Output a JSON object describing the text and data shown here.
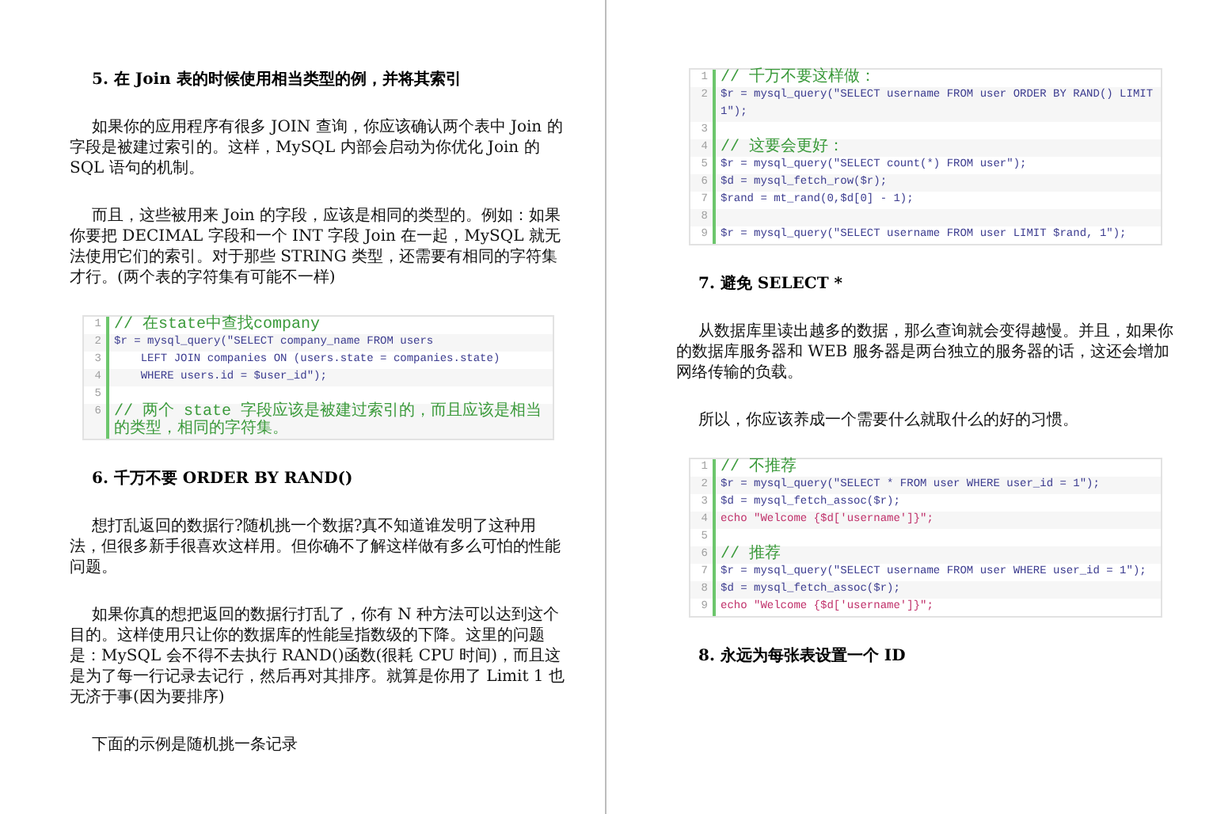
{
  "pages": [
    {
      "blocks": [
        {
          "kind": "heading",
          "text": "5. 在 Join 表的时候使用相当类型的例，并将其索引"
        },
        {
          "kind": "paragraph",
          "text": "如果你的应用程序有很多 JOIN 查询，你应该确认两个表中 Join 的字段是被建过索引的。这样，MySQL 内部会启动为你优化 Join 的 SQL 语句的机制。"
        },
        {
          "kind": "paragraph",
          "text": "而且，这些被用来 Join 的字段，应该是相同的类型的。例如：如果你要把 DECIMAL 字段和一个 INT 字段 Join 在一起，MySQL 就无法使用它们的索引。对于那些 STRING 类型，还需要有相同的字符集才行。(两个表的字符集有可能不一样)"
        },
        {
          "kind": "code",
          "lines": [
            {
              "num": "1",
              "kind": "comment",
              "text": "// 在state中查找company"
            },
            {
              "num": "2",
              "kind": "code",
              "text": "$r = mysql_query(\"SELECT company_name FROM users"
            },
            {
              "num": "3",
              "kind": "code",
              "text": "    LEFT JOIN companies ON (users.state = companies.state)"
            },
            {
              "num": "4",
              "kind": "code",
              "text": "    WHERE users.id = $user_id\");"
            },
            {
              "num": "5",
              "kind": "blank"
            },
            {
              "num": "6",
              "kind": "comment",
              "text": "// 两个 state 字段应该是被建过索引的，而且应该是相当的类型，相同的字符集。"
            }
          ]
        },
        {
          "kind": "heading",
          "text": "6. 千万不要 ORDER BY RAND()"
        },
        {
          "kind": "paragraph",
          "text": "想打乱返回的数据行?随机挑一个数据?真不知道谁发明了这种用法，但很多新手很喜欢这样用。但你确不了解这样做有多么可怕的性能问题。"
        },
        {
          "kind": "paragraph",
          "text": "如果你真的想把返回的数据行打乱了，你有 N 种方法可以达到这个目的。这样使用只让你的数据库的性能呈指数级的下降。这里的问题是：MySQL 会不得不去执行 RAND()函数(很耗 CPU 时间)，而且这是为了每一行记录去记行，然后再对其排序。就算是你用了 Limit 1 也无济于事(因为要排序)"
        },
        {
          "kind": "paragraph",
          "text": "下面的示例是随机挑一条记录"
        }
      ]
    },
    {
      "blocks": [
        {
          "kind": "code",
          "lines": [
            {
              "num": "1",
              "kind": "comment",
              "text": "// 千万不要这样做："
            },
            {
              "num": "2",
              "kind": "code",
              "text": "$r = mysql_query(\"SELECT username FROM user ORDER BY RAND() LIMIT 1\");"
            },
            {
              "num": "3",
              "kind": "blank"
            },
            {
              "num": "4",
              "kind": "comment",
              "text": "// 这要会更好："
            },
            {
              "num": "5",
              "kind": "code",
              "text": "$r = mysql_query(\"SELECT count(*) FROM user\");"
            },
            {
              "num": "6",
              "kind": "code",
              "text": "$d = mysql_fetch_row($r);"
            },
            {
              "num": "7",
              "kind": "code",
              "text": "$rand = mt_rand(0,$d[0] - 1);"
            },
            {
              "num": "8",
              "kind": "blank"
            },
            {
              "num": "9",
              "kind": "code",
              "text": "$r = mysql_query(\"SELECT username FROM user LIMIT $rand, 1\");"
            }
          ]
        },
        {
          "kind": "heading",
          "text": "7. 避免 SELECT *"
        },
        {
          "kind": "paragraph",
          "text": "从数据库里读出越多的数据，那么查询就会变得越慢。并且，如果你的数据库服务器和 WEB 服务器是两台独立的服务器的话，这还会增加网络传输的负载。"
        },
        {
          "kind": "paragraph",
          "text": "所以，你应该养成一个需要什么就取什么的好的习惯。"
        },
        {
          "kind": "code",
          "lines": [
            {
              "num": "1",
              "kind": "comment",
              "text": "// 不推荐"
            },
            {
              "num": "2",
              "kind": "code",
              "text": "$r = mysql_query(\"SELECT * FROM user WHERE user_id = 1\");"
            },
            {
              "num": "3",
              "kind": "code",
              "text": "$d = mysql_fetch_assoc($r);"
            },
            {
              "num": "4",
              "kind": "echo",
              "text": "echo \"Welcome {$d['username']}\";"
            },
            {
              "num": "5",
              "kind": "blank"
            },
            {
              "num": "6",
              "kind": "comment",
              "text": "// 推荐"
            },
            {
              "num": "7",
              "kind": "code",
              "text": "$r = mysql_query(\"SELECT username FROM user WHERE user_id = 1\");"
            },
            {
              "num": "8",
              "kind": "code",
              "text": "$d = mysql_fetch_assoc($r);"
            },
            {
              "num": "9",
              "kind": "echo",
              "text": "echo \"Welcome {$d['username']}\";"
            }
          ]
        },
        {
          "kind": "heading",
          "text": "8. 永远为每张表设置一个 ID"
        }
      ]
    }
  ]
}
